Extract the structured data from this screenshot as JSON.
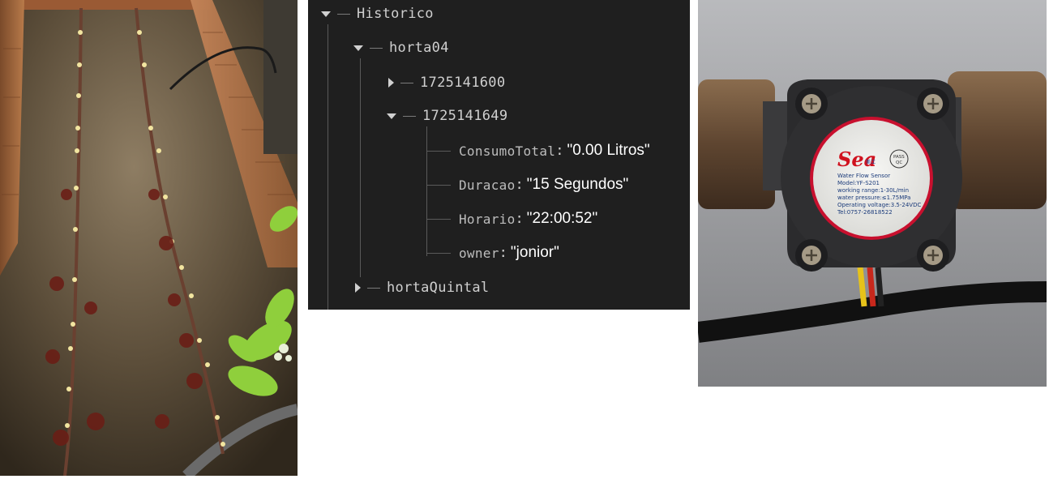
{
  "garden_photo": {
    "description_icon": "garden-bed-photo"
  },
  "tree": {
    "root": {
      "key": "Historico",
      "expanded": true
    },
    "children": [
      {
        "key": "horta04",
        "expanded": true,
        "children": [
          {
            "key": "1725141600",
            "expanded": false
          },
          {
            "key": "1725141649",
            "expanded": true,
            "leaves": [
              {
                "key": "ConsumoTotal",
                "value": "\"0.00 Litros\""
              },
              {
                "key": "Duracao",
                "value": "\"15 Segundos\""
              },
              {
                "key": "Horario",
                "value": "\"22:00:52\""
              },
              {
                "key": "owner",
                "value": "\"jonior\""
              }
            ]
          }
        ]
      },
      {
        "key": "hortaQuintal",
        "expanded": false
      }
    ]
  },
  "sensor_photo": {
    "label": {
      "brand": "Sea",
      "brand_cn": "美江",
      "badge_line1": "PASS",
      "badge_line2": "QC",
      "line1": "Water Flow Sensor",
      "line2": "Model:YF-S201",
      "line3": "working range:1-30L/min",
      "line4": "water pressure:≤1.75MPa",
      "line5": "Operating voltage:3.5-24VDC",
      "line6": "Tel:0757-26818522"
    },
    "colors": {
      "body": "#2b2b2d",
      "label_ring": "#c8102e",
      "fitting": "#6b5238"
    }
  }
}
